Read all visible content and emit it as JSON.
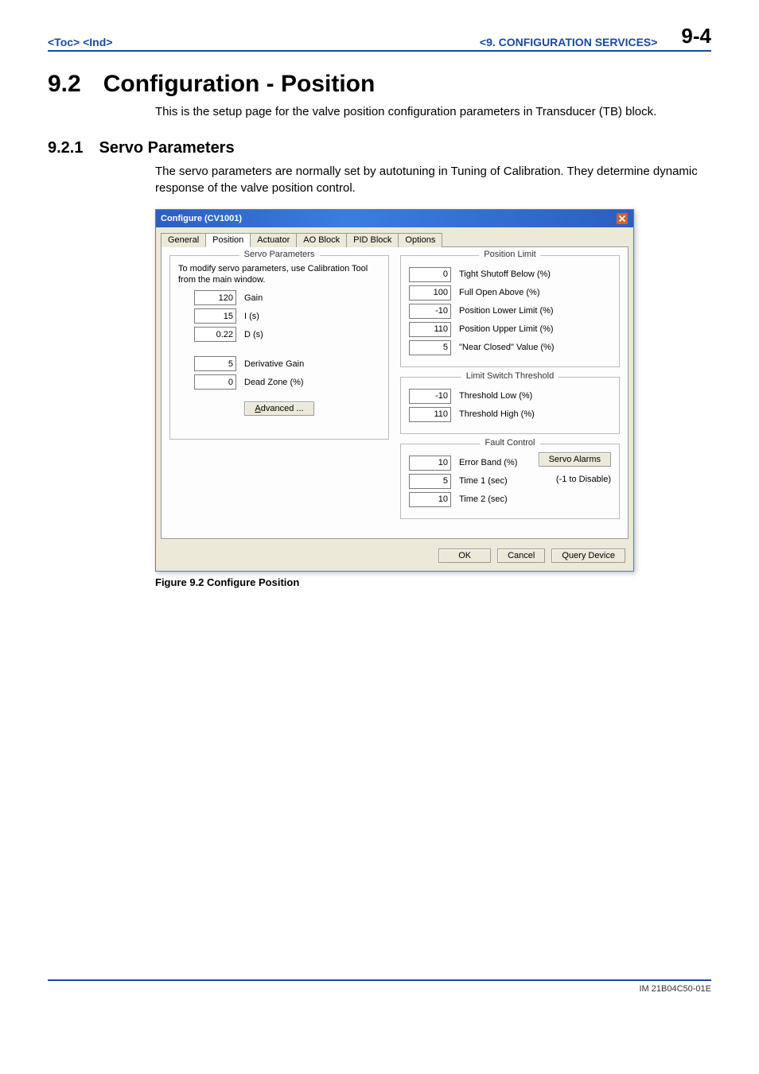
{
  "header": {
    "toc": "<Toc>",
    "ind": "<Ind>",
    "chapter": "<9.  CONFIGURATION SERVICES>",
    "pageNum": "9-4"
  },
  "section": {
    "number": "9.2",
    "title": "Configuration - Position",
    "intro": "This is the setup page for the valve position configuration parameters in Transducer (TB) block."
  },
  "subsection": {
    "number": "9.2.1",
    "title": "Servo Parameters",
    "intro": "The servo parameters are normally set by autotuning in Tuning of Calibration.  They determine dynamic response of the valve position control."
  },
  "dialog": {
    "title": "Configure (CV1001)",
    "tabs": [
      "General",
      "Position",
      "Actuator",
      "AO Block",
      "PID Block",
      "Options"
    ],
    "activeTab": 1,
    "servo": {
      "legend": "Servo Parameters",
      "note": "To modify servo parameters, use Calibration Tool from the main window.",
      "fields": [
        {
          "value": "120",
          "label": "Gain"
        },
        {
          "value": "15",
          "label": "I  (s)"
        },
        {
          "value": "0.22",
          "label": "D  (s)"
        },
        {
          "value": "5",
          "label": "Derivative Gain"
        },
        {
          "value": "0",
          "label": "Dead Zone (%)"
        }
      ],
      "advanced": "Advanced ..."
    },
    "positionLimit": {
      "legend": "Position Limit",
      "fields": [
        {
          "value": "0",
          "label": "Tight Shutoff Below (%)"
        },
        {
          "value": "100",
          "label": "Full Open Above (%)"
        },
        {
          "value": "-10",
          "label": "Position Lower Limit (%)"
        },
        {
          "value": "110",
          "label": "Position Upper Limit (%)"
        },
        {
          "value": "5",
          "label": "\"Near Closed\" Value (%)"
        }
      ]
    },
    "limitSwitch": {
      "legend": "Limit Switch Threshold",
      "fields": [
        {
          "value": "-10",
          "label": "Threshold Low (%)"
        },
        {
          "value": "110",
          "label": "Threshold High (%)"
        }
      ]
    },
    "faultControl": {
      "legend": "Fault Control",
      "fields": [
        {
          "value": "10",
          "label": "Error Band (%)"
        },
        {
          "value": "5",
          "label": "Time 1 (sec)"
        },
        {
          "value": "10",
          "label": "Time 2 (sec)"
        }
      ],
      "servoAlarms": "Servo Alarms",
      "disableNote": "(-1 to Disable)"
    },
    "buttons": {
      "ok": "OK",
      "cancel": "Cancel",
      "query": "Query Device"
    }
  },
  "figureCaption": "Figure 9.2 Configure Position",
  "footer": "IM 21B04C50-01E"
}
